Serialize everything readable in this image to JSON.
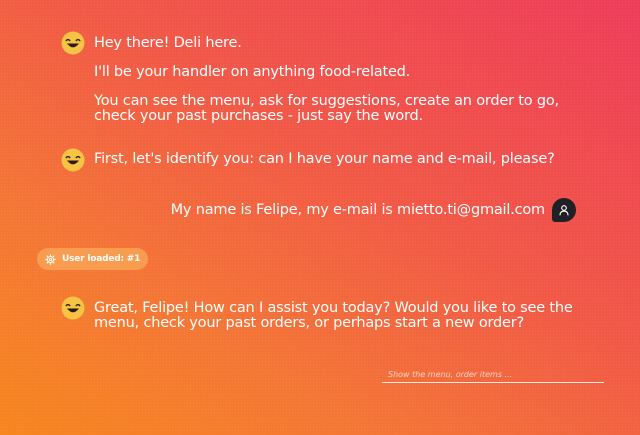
{
  "conversation": {
    "bot_messages": [
      {
        "paragraphs": [
          "Hey there! Deli here.",
          "I'll be your handler on anything food-related.",
          "You can see the menu, ask for suggestions, create an order to go, check your past purchases - just say the word."
        ]
      },
      {
        "paragraphs": [
          "First, let's identify you: can I have your name and e-mail, please?"
        ]
      },
      {
        "paragraphs": [
          "Great, Felipe! How can I assist you today? Would you like to see the menu, check your past orders, or perhaps start a new order?"
        ]
      }
    ],
    "user_message": "My name is Felipe, my e-mail is mietto.ti@gmail.com",
    "status_badge": "User loaded: #1"
  },
  "composer": {
    "placeholder": "Show the menu, order items ..."
  },
  "icons": {
    "bot_avatar": "smiley-face-icon",
    "user_avatar": "user-icon",
    "badge": "gear-icon"
  },
  "colors": {
    "bot_face": "#f6c445",
    "user_avatar_bg": "#202126",
    "badge_bg": "#f89c50"
  }
}
